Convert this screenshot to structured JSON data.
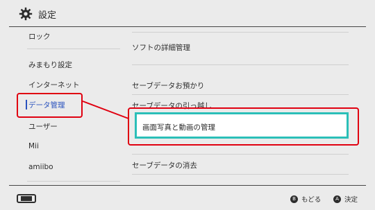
{
  "header": {
    "title": "設定",
    "icon": "gear-icon"
  },
  "sidebar": {
    "items": [
      {
        "label": "ロック"
      },
      {
        "label": "みまもり設定"
      },
      {
        "label": "インターネット"
      },
      {
        "label": "データ管理",
        "selected": true
      },
      {
        "label": "ユーザー"
      },
      {
        "label": "Mii"
      },
      {
        "label": "amiibo"
      }
    ]
  },
  "content": {
    "items": [
      {
        "label": "ソフトの詳細管理"
      },
      {
        "label": "セーブデータお預かり"
      },
      {
        "label": "セーブデータの引っ越し"
      },
      {
        "label": "画面写真と動画の管理",
        "focused": true
      },
      {
        "label": "セーブデータの消去"
      }
    ]
  },
  "footer": {
    "back": {
      "button": "B",
      "label": "もどる"
    },
    "confirm": {
      "button": "A",
      "label": "決定"
    }
  },
  "colors": {
    "accent": "#2a52be",
    "focus": "#2bbfb8",
    "annotation": "#e00010",
    "background": "#ebebeb"
  }
}
